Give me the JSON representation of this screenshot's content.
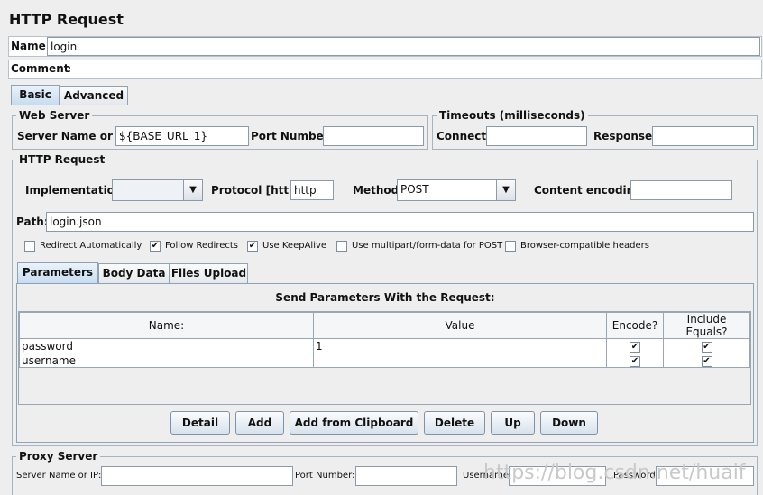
{
  "title": "HTTP Request",
  "name_label": "Name:",
  "name_value": "login",
  "comments_label": "Comments:",
  "tabs": [
    {
      "label": "Basic",
      "active": true
    },
    {
      "label": "Advanced",
      "active": false
    }
  ],
  "web_server": {
    "legend": "Web Server",
    "server_label": "Server Name or IP:",
    "server_value": "${BASE_URL_1}",
    "port_label": "Port Number:",
    "port_value": ""
  },
  "timeouts": {
    "legend": "Timeouts (milliseconds)",
    "connect_label": "Connect:",
    "connect_value": "",
    "response_label": "Response:",
    "response_value": ""
  },
  "http_request": {
    "legend": "HTTP Request",
    "implementation_label": "Implementation:",
    "implementation_value": "",
    "protocol_label": "Protocol [http]:",
    "protocol_value": "http",
    "method_label": "Method:",
    "method_value": "POST",
    "encoding_label": "Content encoding:",
    "encoding_value": "",
    "path_label": "Path:",
    "path_value": "login.json"
  },
  "checkboxes": [
    {
      "label": "Redirect Automatically",
      "checked": false,
      "mark": ""
    },
    {
      "label": "Follow Redirects",
      "checked": true,
      "mark": "✔"
    },
    {
      "label": "Use KeepAlive",
      "checked": true,
      "mark": "✔"
    },
    {
      "label": "Use multipart/form-data for POST",
      "checked": false,
      "mark": ""
    },
    {
      "label": "Browser-compatible headers",
      "checked": false,
      "mark": ""
    }
  ],
  "subtabs": [
    {
      "label": "Parameters",
      "active": true
    },
    {
      "label": "Body Data",
      "active": false
    },
    {
      "label": "Files Upload",
      "active": false
    }
  ],
  "params": {
    "heading": "Send Parameters With the Request:",
    "columns": [
      "Name:",
      "Value",
      "Encode?",
      "Include Equals?"
    ],
    "rows": [
      {
        "name": "password",
        "value": "1",
        "encode": "✔",
        "include": "✔"
      },
      {
        "name": "username",
        "value": "",
        "encode": "✔",
        "include": "✔"
      }
    ]
  },
  "buttons": [
    "Detail",
    "Add",
    "Add from Clipboard",
    "Delete",
    "Up",
    "Down"
  ],
  "proxy": {
    "legend": "Proxy Server",
    "server_label": "Server Name or IP:",
    "port_label": "Port Number:",
    "username_label": "Username",
    "password_label": "Password"
  },
  "watermark": "https://blog.csdn.net/huaif"
}
